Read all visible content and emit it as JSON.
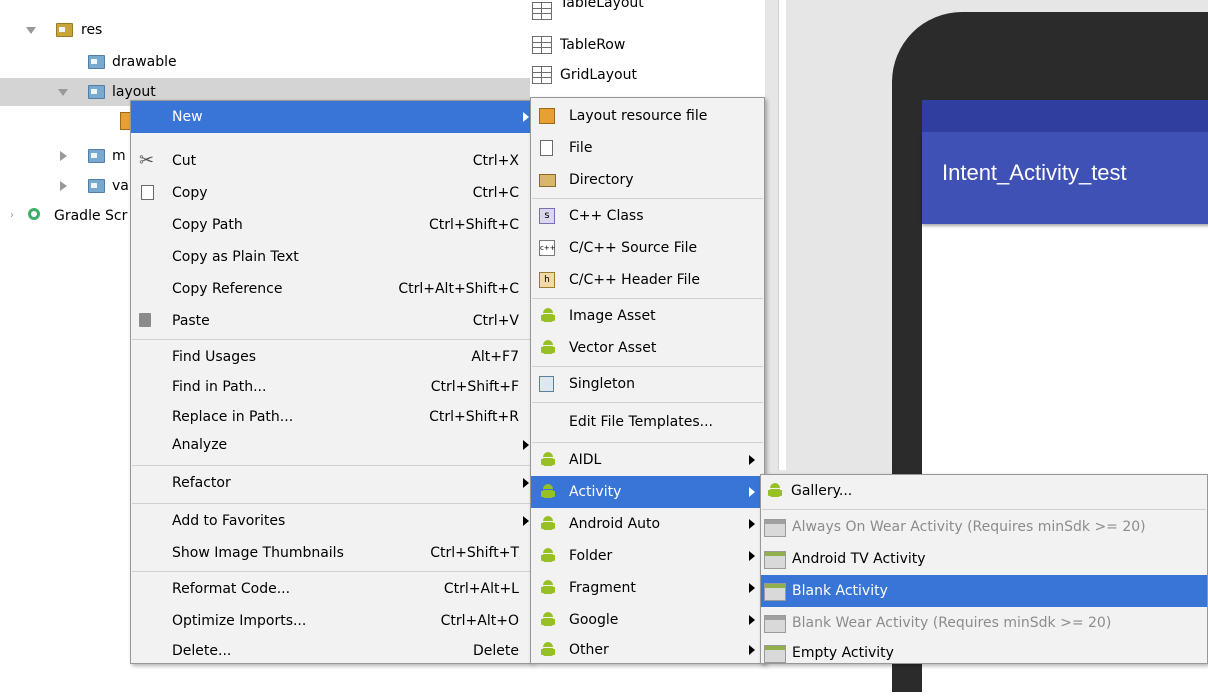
{
  "tree": {
    "items": [
      {
        "label": "res"
      },
      {
        "label": "drawable"
      },
      {
        "label": "layout"
      },
      {
        "label": "m"
      },
      {
        "label": "va"
      },
      {
        "label": "Gradle Scr"
      }
    ]
  },
  "palette": {
    "items": [
      {
        "label": "TableLayout"
      },
      {
        "label": "TableRow"
      },
      {
        "label": "GridLayout"
      }
    ]
  },
  "preview": {
    "app_title": "Intent_Activity_test",
    "colors": {
      "app_bar": "#3f51b5",
      "status_bar": "#303f9f",
      "selection": "#3875d7"
    }
  },
  "context_menu": {
    "items": [
      {
        "label": "New",
        "shortcut": ""
      },
      {
        "label": "Cut",
        "shortcut": "Ctrl+X"
      },
      {
        "label": "Copy",
        "shortcut": "Ctrl+C"
      },
      {
        "label": "Copy Path",
        "shortcut": "Ctrl+Shift+C"
      },
      {
        "label": "Copy as Plain Text",
        "shortcut": ""
      },
      {
        "label": "Copy Reference",
        "shortcut": "Ctrl+Alt+Shift+C"
      },
      {
        "label": "Paste",
        "shortcut": "Ctrl+V"
      },
      {
        "label": "Find Usages",
        "shortcut": "Alt+F7"
      },
      {
        "label": "Find in Path...",
        "shortcut": "Ctrl+Shift+F"
      },
      {
        "label": "Replace in Path...",
        "shortcut": "Ctrl+Shift+R"
      },
      {
        "label": "Analyze",
        "shortcut": ""
      },
      {
        "label": "Refactor",
        "shortcut": ""
      },
      {
        "label": "Add to Favorites",
        "shortcut": ""
      },
      {
        "label": "Show Image Thumbnails",
        "shortcut": "Ctrl+Shift+T"
      },
      {
        "label": "Reformat Code...",
        "shortcut": "Ctrl+Alt+L"
      },
      {
        "label": "Optimize Imports...",
        "shortcut": "Ctrl+Alt+O"
      },
      {
        "label": "Delete...",
        "shortcut": "Delete"
      }
    ]
  },
  "new_menu": {
    "items": [
      {
        "label": "Layout resource file"
      },
      {
        "label": "File"
      },
      {
        "label": "Directory"
      },
      {
        "label": "C++ Class"
      },
      {
        "label": "C/C++ Source File"
      },
      {
        "label": "C/C++ Header File"
      },
      {
        "label": "Image Asset"
      },
      {
        "label": "Vector Asset"
      },
      {
        "label": "Singleton"
      },
      {
        "label": "Edit File Templates..."
      },
      {
        "label": "AIDL"
      },
      {
        "label": "Activity"
      },
      {
        "label": "Android Auto"
      },
      {
        "label": "Folder"
      },
      {
        "label": "Fragment"
      },
      {
        "label": "Google"
      },
      {
        "label": "Other"
      }
    ]
  },
  "activity_menu": {
    "items": [
      {
        "label": "Gallery..."
      },
      {
        "label": "Always On Wear Activity (Requires minSdk >= 20)"
      },
      {
        "label": "Android TV Activity"
      },
      {
        "label": "Blank Activity"
      },
      {
        "label": "Blank Wear Activity (Requires minSdk >= 20)"
      },
      {
        "label": "Empty Activity"
      }
    ]
  }
}
